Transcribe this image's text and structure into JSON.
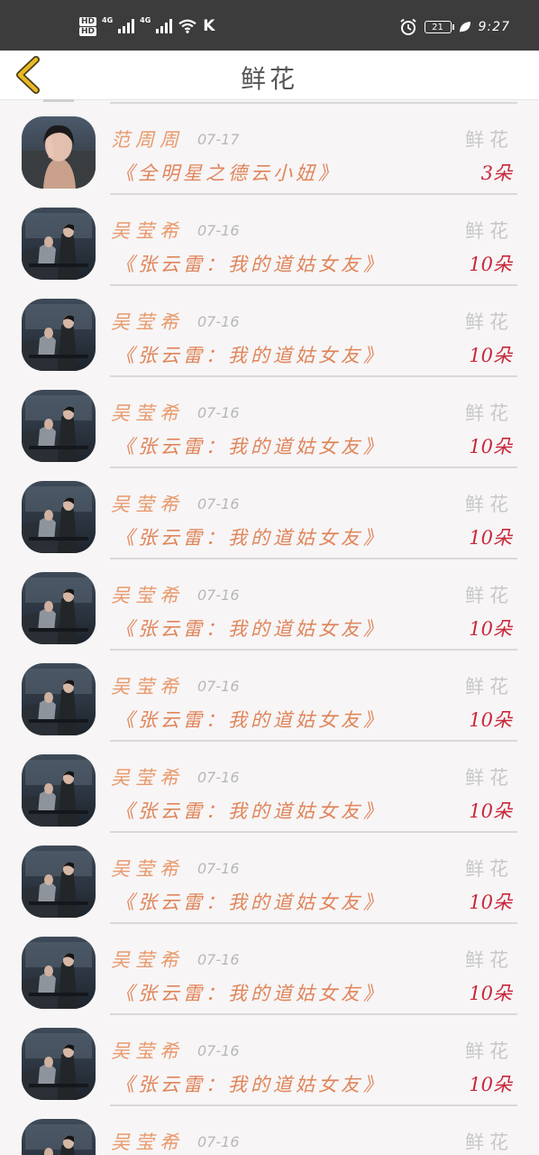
{
  "status_bar": {
    "hd1": "HD",
    "hd2": "HD",
    "net1": "4G",
    "net2": "4G",
    "carrier_k": "K",
    "battery": "21",
    "time": "9:27",
    "icons": [
      "signal-icon",
      "wifi-icon",
      "alarm-icon",
      "battery-icon",
      "leaf-icon"
    ]
  },
  "header": {
    "title": "鲜花",
    "back_icon": "chevron-left-icon"
  },
  "colors": {
    "accent": "#e89a6c",
    "count": "#c8283a",
    "back": "#e9b923"
  },
  "rows": [
    {
      "name": "范周周",
      "date": "07-17",
      "kind": "鲜花",
      "work": "《全明星之德云小妞》",
      "count": "3朵",
      "avatar": "portrait"
    },
    {
      "name": "吴莹希",
      "date": "07-16",
      "kind": "鲜花",
      "work": "《张云雷：我的道姑女友》",
      "count": "10朵",
      "avatar": "couple"
    },
    {
      "name": "吴莹希",
      "date": "07-16",
      "kind": "鲜花",
      "work": "《张云雷：我的道姑女友》",
      "count": "10朵",
      "avatar": "couple"
    },
    {
      "name": "吴莹希",
      "date": "07-16",
      "kind": "鲜花",
      "work": "《张云雷：我的道姑女友》",
      "count": "10朵",
      "avatar": "couple"
    },
    {
      "name": "吴莹希",
      "date": "07-16",
      "kind": "鲜花",
      "work": "《张云雷：我的道姑女友》",
      "count": "10朵",
      "avatar": "couple"
    },
    {
      "name": "吴莹希",
      "date": "07-16",
      "kind": "鲜花",
      "work": "《张云雷：我的道姑女友》",
      "count": "10朵",
      "avatar": "couple"
    },
    {
      "name": "吴莹希",
      "date": "07-16",
      "kind": "鲜花",
      "work": "《张云雷：我的道姑女友》",
      "count": "10朵",
      "avatar": "couple"
    },
    {
      "name": "吴莹希",
      "date": "07-16",
      "kind": "鲜花",
      "work": "《张云雷：我的道姑女友》",
      "count": "10朵",
      "avatar": "couple"
    },
    {
      "name": "吴莹希",
      "date": "07-16",
      "kind": "鲜花",
      "work": "《张云雷：我的道姑女友》",
      "count": "10朵",
      "avatar": "couple"
    },
    {
      "name": "吴莹希",
      "date": "07-16",
      "kind": "鲜花",
      "work": "《张云雷：我的道姑女友》",
      "count": "10朵",
      "avatar": "couple"
    },
    {
      "name": "吴莹希",
      "date": "07-16",
      "kind": "鲜花",
      "work": "《张云雷：我的道姑女友》",
      "count": "10朵",
      "avatar": "couple"
    },
    {
      "name": "吴莹希",
      "date": "07-16",
      "kind": "鲜花",
      "work": "",
      "count": "",
      "avatar": "couple"
    }
  ]
}
